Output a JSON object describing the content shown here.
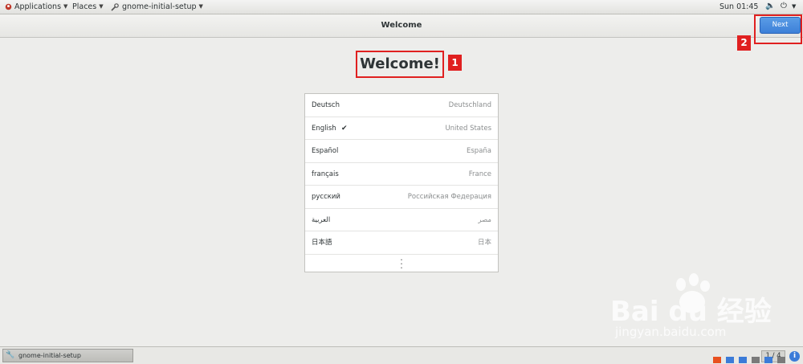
{
  "topbar": {
    "applications": "Applications",
    "places": "Places",
    "active_app": "gnome-initial-setup",
    "clock": "Sun 01:45",
    "volume_icon": "volume-icon",
    "power_icon": "power-icon"
  },
  "header": {
    "title": "Welcome",
    "next_label": "Next"
  },
  "main": {
    "heading": "Welcome!"
  },
  "languages": [
    {
      "name": "Deutsch",
      "country": "Deutschland",
      "selected": false
    },
    {
      "name": "English",
      "country": "United States",
      "selected": true
    },
    {
      "name": "Español",
      "country": "España",
      "selected": false
    },
    {
      "name": "français",
      "country": "France",
      "selected": false
    },
    {
      "name": "русский",
      "country": "Российская Федерация",
      "selected": false
    },
    {
      "name": "العربية",
      "country": "مصر",
      "selected": false
    },
    {
      "name": "日本語",
      "country": "日本",
      "selected": false
    }
  ],
  "annotations": [
    {
      "label": "1"
    },
    {
      "label": "2"
    }
  ],
  "bottombar": {
    "task_label": "gnome-initial-setup",
    "workspace": "1 / 4",
    "info_icon": "i"
  },
  "watermark": {
    "main": "Bai du 经验",
    "sub": "jingyan.baidu.com"
  },
  "colors": {
    "accent": "#4a90e2",
    "annotation": "#e02020",
    "background": "#ededeb"
  }
}
